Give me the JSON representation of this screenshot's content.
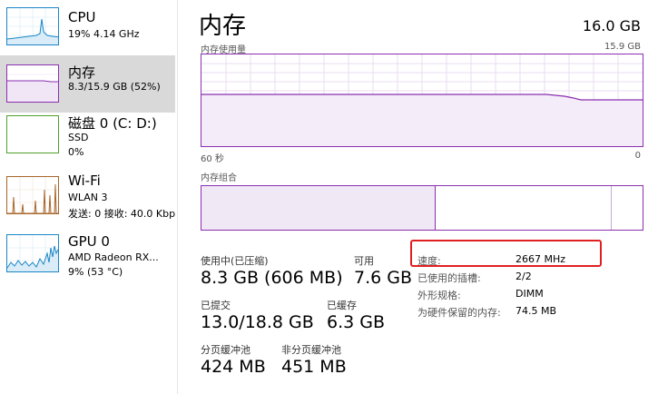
{
  "sidebar": {
    "items": [
      {
        "title": "CPU",
        "sub1": "19% 4.14 GHz",
        "sub2": "",
        "color": "#1a86c7",
        "icon": "cpu-graph-icon"
      },
      {
        "title": "内存",
        "sub1": "8.3/15.9 GB (52%)",
        "sub2": "",
        "color": "#8b2fb0",
        "icon": "memory-graph-icon"
      },
      {
        "title": "磁盘 0 (C: D:)",
        "sub1": "SSD",
        "sub2": "0%",
        "color": "#4fa02a",
        "icon": "disk-graph-icon"
      },
      {
        "title": "Wi-Fi",
        "sub1": "WLAN 3",
        "sub2": "发送: 0 接收: 40.0 Kbps",
        "color": "#a7662b",
        "icon": "network-graph-icon"
      },
      {
        "title": "GPU 0",
        "sub1": "AMD Radeon RX...",
        "sub2": "9% (53 °C)",
        "color": "#1a86c7",
        "icon": "gpu-graph-icon"
      }
    ]
  },
  "main": {
    "title": "内存",
    "total": "16.0 GB",
    "usage_label": "内存使用量",
    "usage_max": "15.9 GB",
    "time_left": "60 秒",
    "time_right": "0",
    "composition_label": "内存组合",
    "accent": "#8b2fb0",
    "highlight": "#e02020"
  },
  "stats": {
    "in_use_label": "使用中(已压缩)",
    "in_use_value": "8.3 GB (606 MB)",
    "available_label": "可用",
    "available_value": "7.6 GB",
    "committed_label": "已提交",
    "committed_value": "13.0/18.8 GB",
    "cached_label": "已缓存",
    "cached_value": "6.3 GB",
    "paged_label": "分页缓冲池",
    "paged_value": "424 MB",
    "nonpaged_label": "非分页缓冲池",
    "nonpaged_value": "451 MB"
  },
  "details": [
    {
      "label": "速度:",
      "value": "2667 MHz"
    },
    {
      "label": "已使用的插槽:",
      "value": "2/2"
    },
    {
      "label": "外形规格:",
      "value": "DIMM"
    },
    {
      "label": "为硬件保留的内存:",
      "value": "74.5 MB"
    }
  ]
}
